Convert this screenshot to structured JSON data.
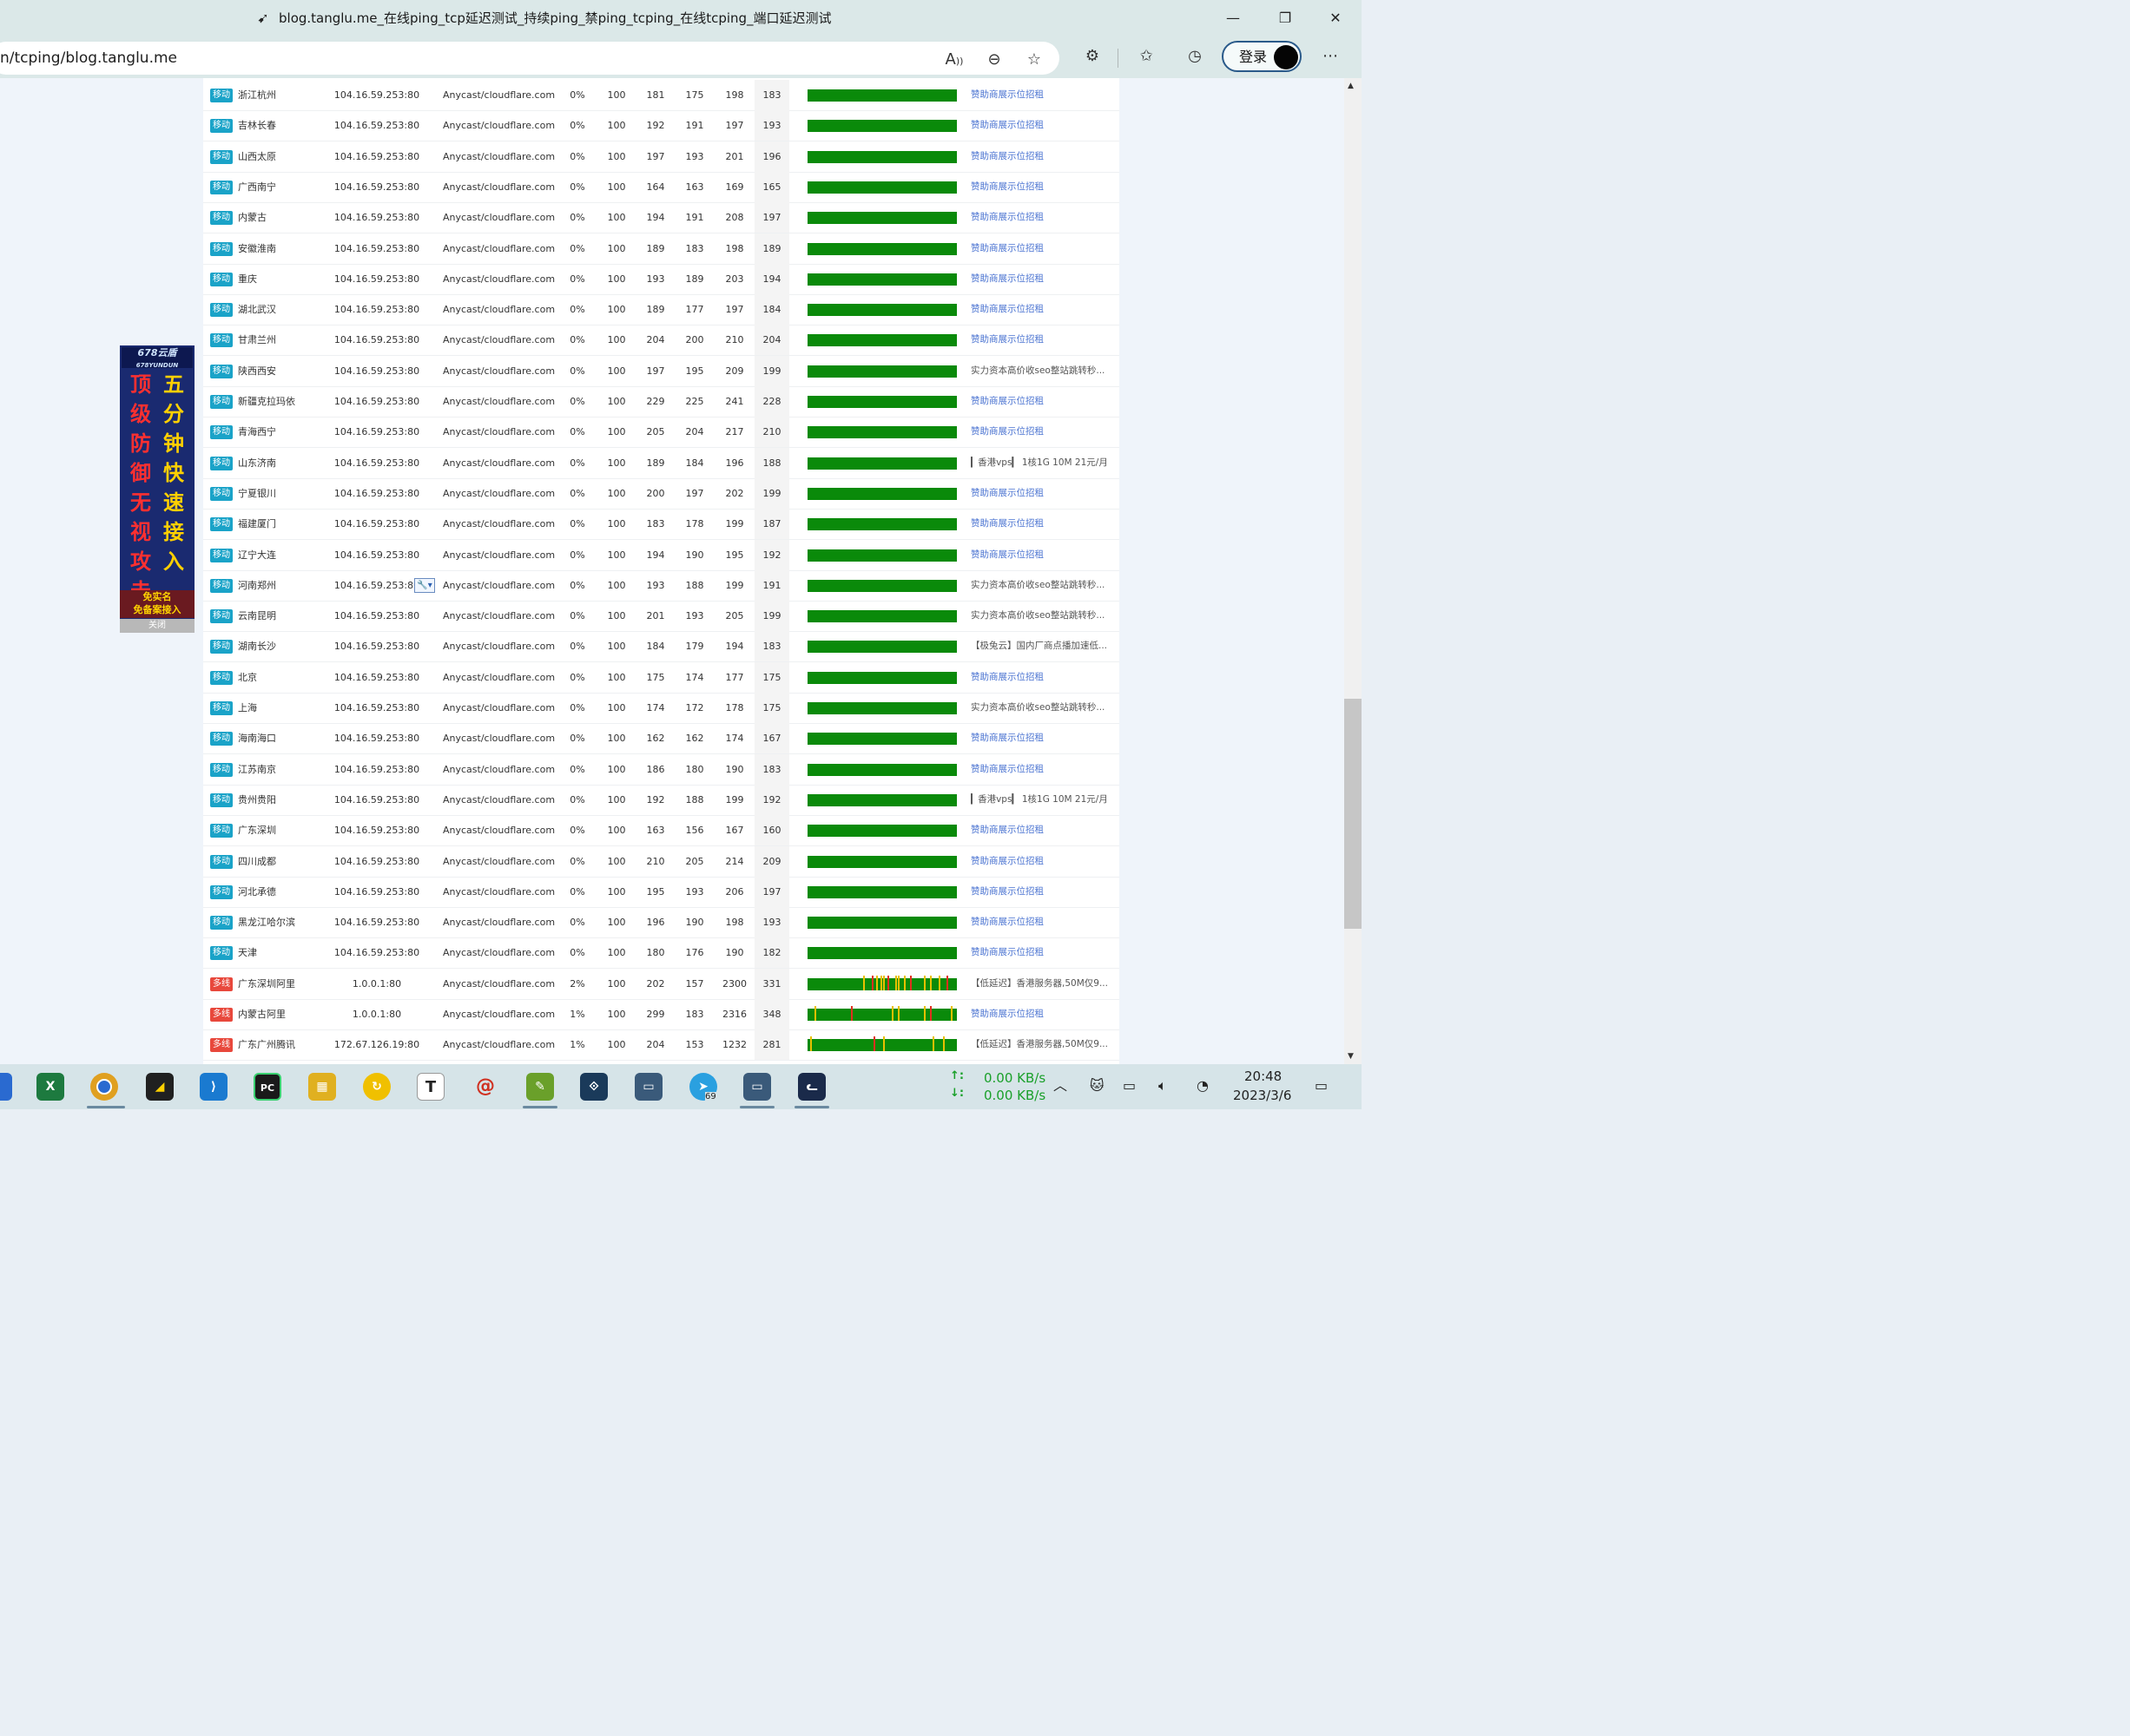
{
  "window": {
    "title": "blog.tanglu.me_在线ping_tcp延迟测试_持续ping_禁ping_tcping_在线tcping_端口延迟测试",
    "minimize": "—",
    "restore": "❐",
    "close": "✕"
  },
  "browser": {
    "url": "n/tcping/blog.tanglu.me",
    "login_label": "登录",
    "icons": [
      "read-aloud-icon",
      "zoom-out-icon",
      "add-favorite-icon",
      "extensions-icon",
      "favorites-icon",
      "history-icon",
      "more-icon"
    ]
  },
  "left_ad": {
    "brand": "678云盾",
    "brand_sub": "678YUNDUN",
    "col1": [
      "顶",
      "级",
      "防",
      "御",
      "无",
      "视",
      "攻",
      "击"
    ],
    "col2": [
      "五",
      "分",
      "钟",
      "快",
      "速",
      "接",
      "入"
    ],
    "footer1": "免实名",
    "footer2": "免备案接入",
    "close_label": "关闭"
  },
  "table": {
    "rows": [
      {
        "isp": "移动",
        "region": "浙江杭州",
        "ip": "104.16.59.253:80",
        "node": "Anycast/cloudflare.com",
        "loss": "0%",
        "sent": "100",
        "last": "181",
        "best": "175",
        "worst": "198",
        "avg": "183",
        "ad": "赞助商展示位招租",
        "ad_link": true,
        "spikes": []
      },
      {
        "isp": "移动",
        "region": "吉林长春",
        "ip": "104.16.59.253:80",
        "node": "Anycast/cloudflare.com",
        "loss": "0%",
        "sent": "100",
        "last": "192",
        "best": "191",
        "worst": "197",
        "avg": "193",
        "ad": "赞助商展示位招租",
        "ad_link": true,
        "spikes": []
      },
      {
        "isp": "移动",
        "region": "山西太原",
        "ip": "104.16.59.253:80",
        "node": "Anycast/cloudflare.com",
        "loss": "0%",
        "sent": "100",
        "last": "197",
        "best": "193",
        "worst": "201",
        "avg": "196",
        "ad": "赞助商展示位招租",
        "ad_link": true,
        "spikes": []
      },
      {
        "isp": "移动",
        "region": "广西南宁",
        "ip": "104.16.59.253:80",
        "node": "Anycast/cloudflare.com",
        "loss": "0%",
        "sent": "100",
        "last": "164",
        "best": "163",
        "worst": "169",
        "avg": "165",
        "ad": "赞助商展示位招租",
        "ad_link": true,
        "spikes": []
      },
      {
        "isp": "移动",
        "region": "内蒙古",
        "ip": "104.16.59.253:80",
        "node": "Anycast/cloudflare.com",
        "loss": "0%",
        "sent": "100",
        "last": "194",
        "best": "191",
        "worst": "208",
        "avg": "197",
        "ad": "赞助商展示位招租",
        "ad_link": true,
        "spikes": []
      },
      {
        "isp": "移动",
        "region": "安徽淮南",
        "ip": "104.16.59.253:80",
        "node": "Anycast/cloudflare.com",
        "loss": "0%",
        "sent": "100",
        "last": "189",
        "best": "183",
        "worst": "198",
        "avg": "189",
        "ad": "赞助商展示位招租",
        "ad_link": true,
        "spikes": []
      },
      {
        "isp": "移动",
        "region": "重庆",
        "ip": "104.16.59.253:80",
        "node": "Anycast/cloudflare.com",
        "loss": "0%",
        "sent": "100",
        "last": "193",
        "best": "189",
        "worst": "203",
        "avg": "194",
        "ad": "赞助商展示位招租",
        "ad_link": true,
        "spikes": []
      },
      {
        "isp": "移动",
        "region": "湖北武汉",
        "ip": "104.16.59.253:80",
        "node": "Anycast/cloudflare.com",
        "loss": "0%",
        "sent": "100",
        "last": "189",
        "best": "177",
        "worst": "197",
        "avg": "184",
        "ad": "赞助商展示位招租",
        "ad_link": true,
        "spikes": []
      },
      {
        "isp": "移动",
        "region": "甘肃兰州",
        "ip": "104.16.59.253:80",
        "node": "Anycast/cloudflare.com",
        "loss": "0%",
        "sent": "100",
        "last": "204",
        "best": "200",
        "worst": "210",
        "avg": "204",
        "ad": "赞助商展示位招租",
        "ad_link": true,
        "spikes": []
      },
      {
        "isp": "移动",
        "region": "陕西西安",
        "ip": "104.16.59.253:80",
        "node": "Anycast/cloudflare.com",
        "loss": "0%",
        "sent": "100",
        "last": "197",
        "best": "195",
        "worst": "209",
        "avg": "199",
        "ad": "实力资本高价收seo整站跳转秒...",
        "ad_link": false,
        "spikes": []
      },
      {
        "isp": "移动",
        "region": "新疆克拉玛依",
        "ip": "104.16.59.253:80",
        "node": "Anycast/cloudflare.com",
        "loss": "0%",
        "sent": "100",
        "last": "229",
        "best": "225",
        "worst": "241",
        "avg": "228",
        "ad": "赞助商展示位招租",
        "ad_link": true,
        "spikes": []
      },
      {
        "isp": "移动",
        "region": "青海西宁",
        "ip": "104.16.59.253:80",
        "node": "Anycast/cloudflare.com",
        "loss": "0%",
        "sent": "100",
        "last": "205",
        "best": "204",
        "worst": "217",
        "avg": "210",
        "ad": "赞助商展示位招租",
        "ad_link": true,
        "spikes": []
      },
      {
        "isp": "移动",
        "region": "山东济南",
        "ip": "104.16.59.253:80",
        "node": "Anycast/cloudflare.com",
        "loss": "0%",
        "sent": "100",
        "last": "189",
        "best": "184",
        "worst": "196",
        "avg": "188",
        "ad": "▎香港vps▎ 1核1G 10M 21元/月",
        "ad_link": false,
        "spikes": []
      },
      {
        "isp": "移动",
        "region": "宁夏银川",
        "ip": "104.16.59.253:80",
        "node": "Anycast/cloudflare.com",
        "loss": "0%",
        "sent": "100",
        "last": "200",
        "best": "197",
        "worst": "202",
        "avg": "199",
        "ad": "赞助商展示位招租",
        "ad_link": true,
        "spikes": []
      },
      {
        "isp": "移动",
        "region": "福建厦门",
        "ip": "104.16.59.253:80",
        "node": "Anycast/cloudflare.com",
        "loss": "0%",
        "sent": "100",
        "last": "183",
        "best": "178",
        "worst": "199",
        "avg": "187",
        "ad": "赞助商展示位招租",
        "ad_link": true,
        "spikes": []
      },
      {
        "isp": "移动",
        "region": "辽宁大连",
        "ip": "104.16.59.253:80",
        "node": "Anycast/cloudflare.com",
        "loss": "0%",
        "sent": "100",
        "last": "194",
        "best": "190",
        "worst": "195",
        "avg": "192",
        "ad": "赞助商展示位招租",
        "ad_link": true,
        "spikes": []
      },
      {
        "isp": "移动",
        "region": "河南郑州",
        "ip": "104.16.59.253:80",
        "node": "Anycast/cloudflare.com",
        "loss": "0%",
        "sent": "100",
        "last": "193",
        "best": "188",
        "worst": "199",
        "avg": "191",
        "ad": "实力资本高价收seo整站跳转秒...",
        "ad_link": false,
        "spikes": [],
        "tool": true
      },
      {
        "isp": "移动",
        "region": "云南昆明",
        "ip": "104.16.59.253:80",
        "node": "Anycast/cloudflare.com",
        "loss": "0%",
        "sent": "100",
        "last": "201",
        "best": "193",
        "worst": "205",
        "avg": "199",
        "ad": "实力资本高价收seo整站跳转秒...",
        "ad_link": false,
        "spikes": []
      },
      {
        "isp": "移动",
        "region": "湖南长沙",
        "ip": "104.16.59.253:80",
        "node": "Anycast/cloudflare.com",
        "loss": "0%",
        "sent": "100",
        "last": "184",
        "best": "179",
        "worst": "194",
        "avg": "183",
        "ad": "【极兔云】国内厂商点播加速低...",
        "ad_link": false,
        "spikes": []
      },
      {
        "isp": "移动",
        "region": "北京",
        "ip": "104.16.59.253:80",
        "node": "Anycast/cloudflare.com",
        "loss": "0%",
        "sent": "100",
        "last": "175",
        "best": "174",
        "worst": "177",
        "avg": "175",
        "ad": "赞助商展示位招租",
        "ad_link": true,
        "spikes": []
      },
      {
        "isp": "移动",
        "region": "上海",
        "ip": "104.16.59.253:80",
        "node": "Anycast/cloudflare.com",
        "loss": "0%",
        "sent": "100",
        "last": "174",
        "best": "172",
        "worst": "178",
        "avg": "175",
        "ad": "实力资本高价收seo整站跳转秒...",
        "ad_link": false,
        "spikes": []
      },
      {
        "isp": "移动",
        "region": "海南海口",
        "ip": "104.16.59.253:80",
        "node": "Anycast/cloudflare.com",
        "loss": "0%",
        "sent": "100",
        "last": "162",
        "best": "162",
        "worst": "174",
        "avg": "167",
        "ad": "赞助商展示位招租",
        "ad_link": true,
        "spikes": []
      },
      {
        "isp": "移动",
        "region": "江苏南京",
        "ip": "104.16.59.253:80",
        "node": "Anycast/cloudflare.com",
        "loss": "0%",
        "sent": "100",
        "last": "186",
        "best": "180",
        "worst": "190",
        "avg": "183",
        "ad": "赞助商展示位招租",
        "ad_link": true,
        "spikes": []
      },
      {
        "isp": "移动",
        "region": "贵州贵阳",
        "ip": "104.16.59.253:80",
        "node": "Anycast/cloudflare.com",
        "loss": "0%",
        "sent": "100",
        "last": "192",
        "best": "188",
        "worst": "199",
        "avg": "192",
        "ad": "▎香港vps▎ 1核1G 10M 21元/月",
        "ad_link": false,
        "spikes": []
      },
      {
        "isp": "移动",
        "region": "广东深圳",
        "ip": "104.16.59.253:80",
        "node": "Anycast/cloudflare.com",
        "loss": "0%",
        "sent": "100",
        "last": "163",
        "best": "156",
        "worst": "167",
        "avg": "160",
        "ad": "赞助商展示位招租",
        "ad_link": true,
        "spikes": []
      },
      {
        "isp": "移动",
        "region": "四川成都",
        "ip": "104.16.59.253:80",
        "node": "Anycast/cloudflare.com",
        "loss": "0%",
        "sent": "100",
        "last": "210",
        "best": "205",
        "worst": "214",
        "avg": "209",
        "ad": "赞助商展示位招租",
        "ad_link": true,
        "spikes": []
      },
      {
        "isp": "移动",
        "region": "河北承德",
        "ip": "104.16.59.253:80",
        "node": "Anycast/cloudflare.com",
        "loss": "0%",
        "sent": "100",
        "last": "195",
        "best": "193",
        "worst": "206",
        "avg": "197",
        "ad": "赞助商展示位招租",
        "ad_link": true,
        "spikes": []
      },
      {
        "isp": "移动",
        "region": "黑龙江哈尔滨",
        "ip": "104.16.59.253:80",
        "node": "Anycast/cloudflare.com",
        "loss": "0%",
        "sent": "100",
        "last": "196",
        "best": "190",
        "worst": "198",
        "avg": "193",
        "ad": "赞助商展示位招租",
        "ad_link": true,
        "spikes": []
      },
      {
        "isp": "移动",
        "region": "天津",
        "ip": "104.16.59.253:80",
        "node": "Anycast/cloudflare.com",
        "loss": "0%",
        "sent": "100",
        "last": "180",
        "best": "176",
        "worst": "190",
        "avg": "182",
        "ad": "赞助商展示位招租",
        "ad_link": true,
        "spikes": []
      },
      {
        "isp": "多线",
        "region": "广东深圳阿里",
        "ip": "1.0.0.1:80",
        "node": "Anycast/cloudflare.com",
        "loss": "2%",
        "sent": "100",
        "last": "202",
        "best": "157",
        "worst": "2300",
        "avg": "331",
        "ad": "【低延迟】香港服务器,50M仅9...",
        "ad_link": false,
        "spikes": [
          0.38,
          0.44,
          0.47,
          0.5,
          0.52,
          0.55,
          0.6,
          0.62,
          0.66,
          0.7,
          0.8,
          0.84,
          0.9,
          0.95
        ]
      },
      {
        "isp": "多线",
        "region": "内蒙古阿里",
        "ip": "1.0.0.1:80",
        "node": "Anycast/cloudflare.com",
        "loss": "1%",
        "sent": "100",
        "last": "299",
        "best": "183",
        "worst": "2316",
        "avg": "348",
        "ad": "赞助商展示位招租",
        "ad_link": true,
        "spikes": [
          0.05,
          0.3,
          0.58,
          0.62,
          0.8,
          0.84,
          0.98
        ]
      },
      {
        "isp": "多线",
        "region": "广东广州腾讯",
        "ip": "172.67.126.19:80",
        "node": "Anycast/cloudflare.com",
        "loss": "1%",
        "sent": "100",
        "last": "204",
        "best": "153",
        "worst": "1232",
        "avg": "281",
        "ad": "【低延迟】香港服务器,50M仅9...",
        "ad_link": false,
        "spikes": [
          0.02,
          0.45,
          0.52,
          0.86,
          0.93
        ]
      }
    ]
  },
  "taskbar": {
    "apps": [
      "excel-icon",
      "chrome-icon",
      "sticky-note-icon",
      "vscode-icon",
      "pycharm-icon",
      "photo-app-icon",
      "sync-app-icon",
      "typora-icon",
      "snail-app-icon",
      "notepad-app-icon",
      "vpn-app-icon",
      "remote-desktop-icon",
      "telegram-icon",
      "remote-desktop-2-icon",
      "cat-app-icon"
    ],
    "telegram_badge": "69",
    "net_up": "0.00 KB/s",
    "net_down": "0.00 KB/s",
    "time": "20:48",
    "date": "2023/3/6",
    "colors": {
      "accent": "#1aa02a"
    }
  },
  "colors": {
    "badge_mobile": "#1aa3c8",
    "badge_multi": "#e8483c",
    "bar_green": "#0a8a0a",
    "link_blue": "#4a73d1"
  }
}
